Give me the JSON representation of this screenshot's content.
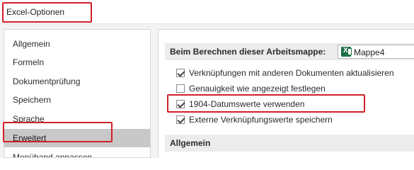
{
  "window": {
    "title": "Excel-Optionen"
  },
  "nav": {
    "items": [
      {
        "label": "Allgemein",
        "selected": false
      },
      {
        "label": "Formeln",
        "selected": false
      },
      {
        "label": "Dokumentprüfung",
        "selected": false
      },
      {
        "label": "Speichern",
        "selected": false
      },
      {
        "label": "Sprache",
        "selected": false
      },
      {
        "label": "Erweitert",
        "selected": true
      },
      {
        "label": "Menüband anpassen",
        "selected": false
      }
    ]
  },
  "calc_section": {
    "label": "Beim Berechnen dieser Arbeitsmappe:",
    "workbook": {
      "name": "Mappe4",
      "icon": "excel-workbook-icon"
    }
  },
  "options": [
    {
      "label": "Verknüpfungen mit anderen Dokumenten aktualisieren",
      "checked": true
    },
    {
      "label": "Genauigkeit wie angezeigt festlegen",
      "checked": false
    },
    {
      "label": "1904-Datumswerte verwenden",
      "checked": true
    },
    {
      "label": "Externe Verknüpfungswerte speichern",
      "checked": true
    }
  ],
  "general_section": {
    "label": "Allgemein"
  },
  "colors": {
    "highlight": "#d0202a",
    "selected_nav": "#c8c8c8",
    "section_band": "#ececec",
    "excel_green": "#1d7044"
  }
}
